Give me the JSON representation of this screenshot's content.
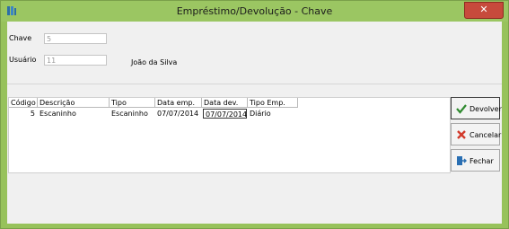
{
  "window": {
    "title": "Empréstimo/Devolução - Chave",
    "close_label": "✕"
  },
  "form": {
    "chave_label": "Chave",
    "chave_value": "5",
    "usuario_label": "Usuário",
    "usuario_value": "11",
    "usuario_name": "João da Silva"
  },
  "grid": {
    "columns": [
      "Código",
      "Descrição",
      "Tipo",
      "Data emp.",
      "Data dev.",
      "Tipo Emp."
    ],
    "rows": [
      [
        "5",
        "Escaninho",
        "Escaninho",
        "07/07/2014",
        "07/07/2014",
        "Diário"
      ]
    ]
  },
  "buttons": {
    "devolver": "Devolver",
    "cancelar": "Cancelar",
    "fechar": "Fechar"
  },
  "colors": {
    "titlebar": "#9bc662",
    "close": "#c74a3c",
    "check": "#2f8a2f",
    "cancel": "#d23a2b",
    "exit": "#2a6fb3"
  }
}
